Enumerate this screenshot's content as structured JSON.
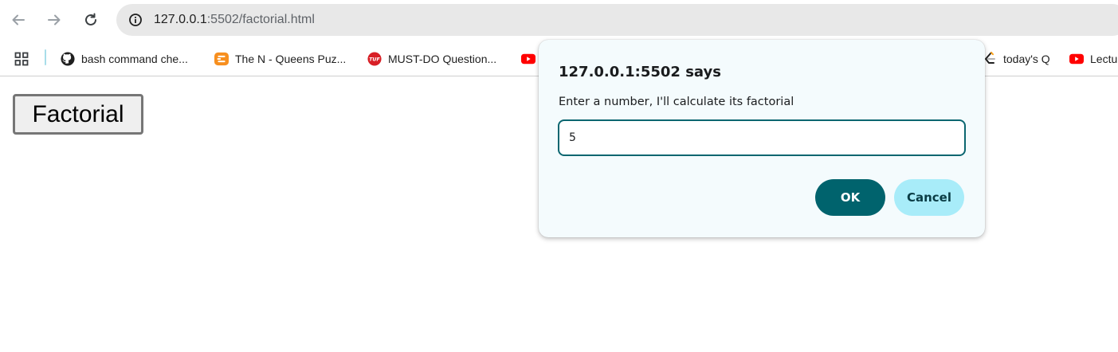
{
  "browser": {
    "nav": {
      "back_icon": "arrow-left-icon",
      "forward_icon": "arrow-right-icon",
      "reload_icon": "reload-icon"
    },
    "omnibox": {
      "host": "127.0.0.1",
      "rest": ":5502/factorial.html",
      "info_icon": "info-icon"
    },
    "bookmarks": {
      "apps_icon": "apps-grid-icon",
      "items": [
        {
          "label": "bash command che...",
          "icon": "github-icon"
        },
        {
          "label": "The N - Queens Puz...",
          "icon": "codingninjas-icon"
        },
        {
          "label": "MUST-DO Question...",
          "icon": "tuf-icon"
        },
        {
          "label": "",
          "icon": "youtube-icon"
        },
        {
          "label": "today's Q",
          "icon": "leetcode-icon"
        },
        {
          "label": "Lectu",
          "icon": "youtube-icon"
        }
      ]
    }
  },
  "page": {
    "button_label": "Factorial"
  },
  "dialog": {
    "title": "127.0.0.1:5502 says",
    "message": "Enter a number, I'll calculate its factorial",
    "input_value": "5",
    "ok_label": "OK",
    "cancel_label": "Cancel"
  },
  "colors": {
    "dialog_bg": "#f4fbfd",
    "input_border": "#0b6670",
    "ok_bg": "#00636d",
    "cancel_bg": "#a8ecf9"
  }
}
